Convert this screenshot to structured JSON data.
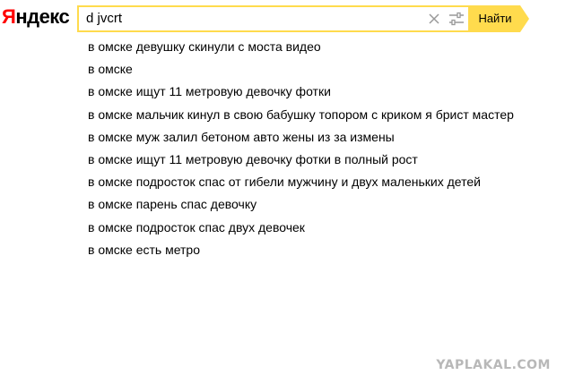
{
  "logo": {
    "first_letter": "Я",
    "rest": "ндекс"
  },
  "search": {
    "query": "d jvcrt",
    "clear_icon": "close-icon",
    "settings_icon": "sliders-icon",
    "button_label": "Найти",
    "accent_color": "#ffdb4d"
  },
  "suggestions": [
    "в омске девушку скинули с моста видео",
    "в омске",
    "в омске ищут 11 метровую девочку фотки",
    "в омске мальчик кинул в свою бабушку топором с криком я брист мастер",
    "в омске муж залил бетоном авто жены из за измены",
    "в омске ищут 11 метровую девочку фотки в полный рост",
    "в омске подросток спас от гибели мужчину и двух маленьких детей",
    "в омске парень спас девочку",
    "в омске подросток спас двух девочек",
    "в омске есть метро"
  ],
  "watermark": "YAPLAKAL.COM"
}
